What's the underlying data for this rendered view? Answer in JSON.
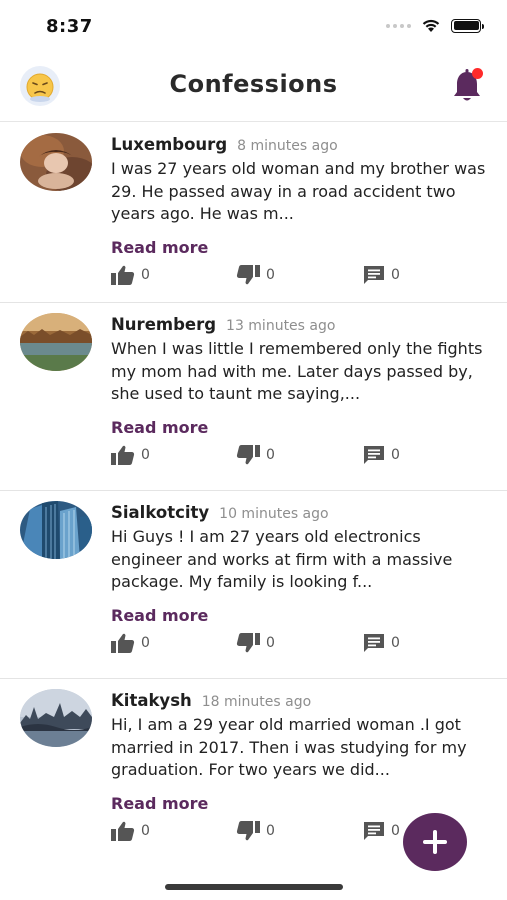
{
  "status_bar": {
    "time": "8:37"
  },
  "header": {
    "title": "Confessions"
  },
  "posts": [
    {
      "name": "Luxembourg",
      "time": "8 minutes ago",
      "text": "I was 27 years old woman and my brother was 29. He passed away in a road accident two years ago. He was m...",
      "read_more": "Read more",
      "likes": "0",
      "dislikes": "0",
      "comments": "0"
    },
    {
      "name": "Nuremberg",
      "time": "13 minutes ago",
      "text": "When I was little I remembered only the fights my mom had with me. Later days passed by, she used to taunt me saying,...",
      "read_more": "Read more",
      "likes": "0",
      "dislikes": "0",
      "comments": "0"
    },
    {
      "name": "Sialkotcity",
      "time": "10 minutes ago",
      "text": "Hi Guys ! I am 27 years old electronics engineer and works at firm with a massive package. My family is looking f...",
      "read_more": "Read more",
      "likes": "0",
      "dislikes": "0",
      "comments": "0"
    },
    {
      "name": "Kitakysh",
      "time": "18 minutes ago",
      "text": "Hi, I am a 29 year old married woman .I got married in 2017. Then i was studying for my graduation. For two years we did...",
      "read_more": "Read more",
      "likes": "0",
      "dislikes": "0",
      "comments": "0"
    }
  ],
  "colors": {
    "accent": "#5b2a5e",
    "notification_dot": "#ff2a2a"
  },
  "icons": [
    "emoji-face-icon",
    "bell-icon",
    "thumbs-up-icon",
    "thumbs-down-icon",
    "comment-icon",
    "plus-icon",
    "wifi-icon",
    "battery-icon"
  ]
}
